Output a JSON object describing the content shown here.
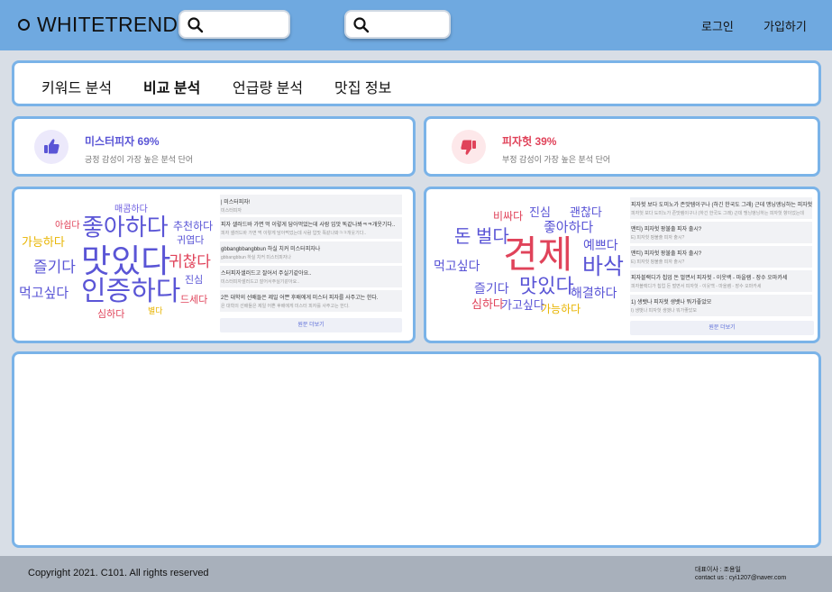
{
  "header": {
    "logo_text": "WHITETREND",
    "login": "로그인",
    "signup": "가입하기"
  },
  "tabs": [
    {
      "label": "키워드 분석"
    },
    {
      "label": "비교 분석"
    },
    {
      "label": "언급량 분석"
    },
    {
      "label": "맛집 정보"
    }
  ],
  "left": {
    "sentiment_title": "미스터피자 69%",
    "sentiment_sub": "긍정 감성이 가장 높은 분석 단어",
    "icon": "thumbs-up-icon",
    "accent": "#5a55d6",
    "words": [
      "매콤하다",
      "아쉽다",
      "좋아하다",
      "추천하다",
      "가능하다",
      "귀엽다",
      "즐기다",
      "맛있다",
      "귀찮다",
      "진심",
      "먹고싶다",
      "인증하다",
      "드세다",
      "심하다",
      "별다"
    ],
    "posts": [
      {
        "title": "| 미스터피자!",
        "sub": "미스터피자"
      },
      {
        "title": "피자 샐러드바 가면 먹 이렇게 담아먹었는데 사람 입맛 똑같나봐ㅋㅋ개웃기다..",
        "sub": "피자 샐러드바 가면 먹 이렇게 담아먹었는데 사람 입맛 똑같나봐ㅋㅋ개웃기다.."
      },
      {
        "title": "gbbangbbangbbun 하실 치커 미스터피자나",
        "sub": "gbbangbbun 하실 치커 미스터피자나"
      },
      {
        "title": "스터피자샐러드고 잘어서 주실기같아요..",
        "sub": "미스터피자샐러드고 잘어서주실기같아요.."
      },
      {
        "title": "2든 대학의 선배들은 제일 어쁜 후배에게 미스터 피자를 사주고는 한다.",
        "sub": "은 대학의 선배들은 제일 어쁜 후배에게 미스터 피자를 사주고는 한다."
      }
    ],
    "more": "원문 더보기"
  },
  "right": {
    "sentiment_title": "피자헛 39%",
    "sentiment_sub": "부정 감성이 가장 높은 분석 단어",
    "icon": "thumbs-down-icon",
    "accent": "#e0435a",
    "words": [
      "비싸다",
      "진심",
      "괜찮다",
      "좋아하다",
      "돈 벌다",
      "견제",
      "예쁘다",
      "바삭",
      "먹고싶다",
      "즐기다",
      "맛있다",
      "해결하다",
      "심하다",
      "가고싶다",
      "가능하다"
    ],
    "posts": [
      {
        "title": "피자헛 보다 도미노가 존맛템이구나 (하긴 한국도 그래) 근데 맹닝앵닝하는 피자헛",
        "sub": "피자헛 보다 도미노가 존맛템이구나 (하긴 한국도 그래) 근데 맹닝앵닝하는 피자헛 향이었는데"
      },
      {
        "title": "맨티) 피자헛 팡불출 피자 출시?",
        "sub": "E) 피자헛 팡불출 피자 출시?"
      },
      {
        "title": "맨티) 피자헛 팡불출 피자 출시?",
        "sub": "E) 피자헛 팡불출 피자 출시?"
      },
      {
        "title": "피자블랙디가 칩업 돈 벌면서 피자헛 - 이웃백 - 마을램 - 장수 오마카세",
        "sub": "피자블랙디가 칩업 돈 벌면서 피자헛 - 이웃백 - 마을램 - 장수 오마카세"
      },
      {
        "title": "1) 생뱃나 피자헛 생뱃나 뭐가좋았모",
        "sub": "I) 생뱃나 피자헛 생뱃나 뭐가좋았모"
      }
    ],
    "more": "원문 더보기"
  },
  "footer": {
    "copyright": "Copyright 2021. C101. All rights reserved",
    "ceo": "대표이사 : 조용일",
    "contact": "contact us : cyi1207@naver.com"
  }
}
